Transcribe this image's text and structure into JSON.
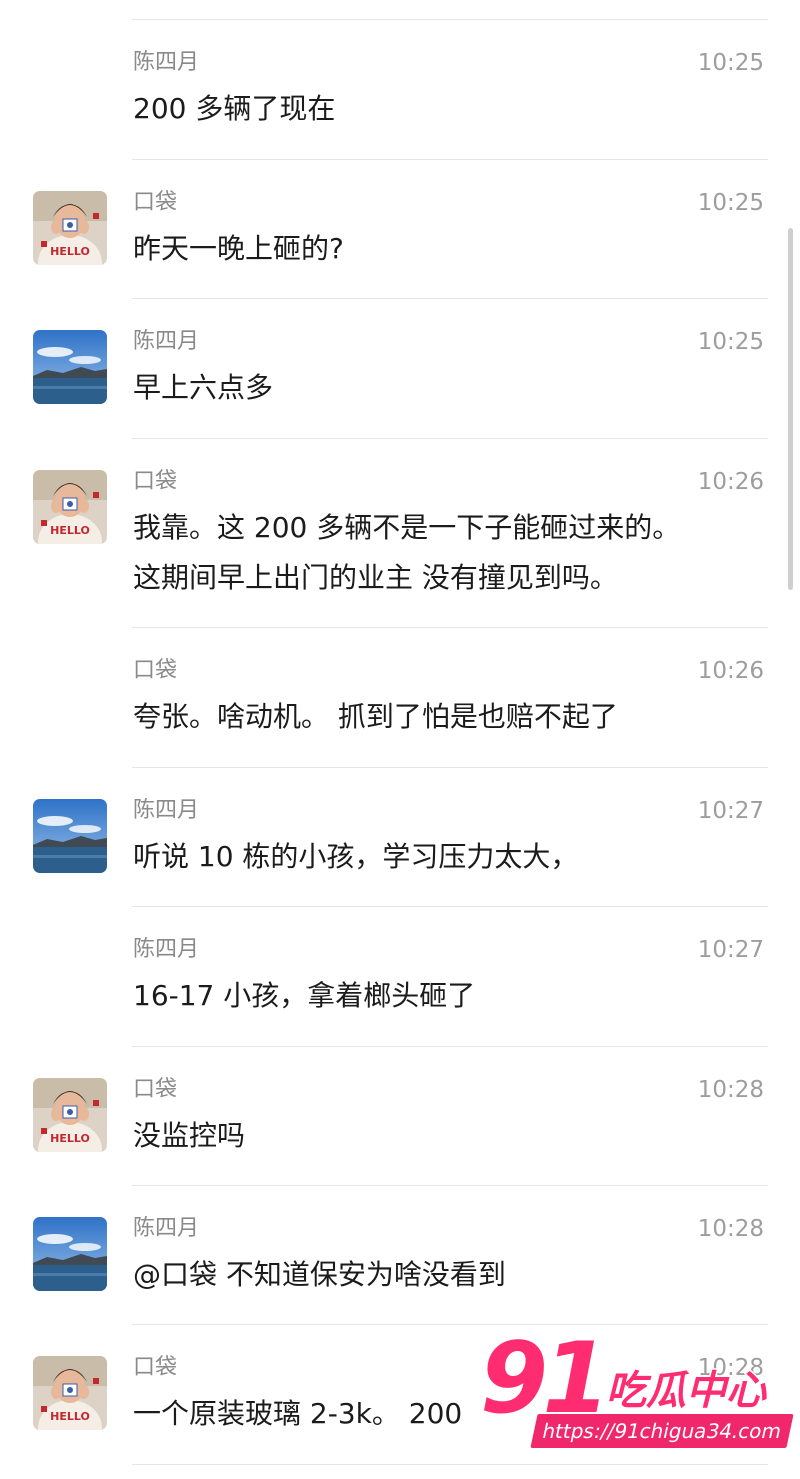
{
  "messages": [
    {
      "sender": "陈四月",
      "time": "10:25",
      "text": [
        "200 多辆了现在"
      ],
      "avatar": "none"
    },
    {
      "sender": "口袋",
      "time": "10:25",
      "text": [
        "昨天一晚上砸的?"
      ],
      "avatar": "koudai"
    },
    {
      "sender": "陈四月",
      "time": "10:25",
      "text": [
        "早上六点多"
      ],
      "avatar": "lake"
    },
    {
      "sender": "口袋",
      "time": "10:26",
      "text": [
        "我靠。这 200 多辆不是一下子能砸过来的。",
        "这期间早上出门的业主 没有撞见到吗。"
      ],
      "avatar": "koudai"
    },
    {
      "sender": "口袋",
      "time": "10:26",
      "text": [
        "夸张。啥动机。 抓到了怕是也赔不起了"
      ],
      "avatar": "none"
    },
    {
      "sender": "陈四月",
      "time": "10:27",
      "text": [
        "听说 10 栋的小孩，学习压力太大，"
      ],
      "avatar": "lake"
    },
    {
      "sender": "陈四月",
      "time": "10:27",
      "text": [
        "16-17 小孩，拿着榔头砸了"
      ],
      "avatar": "none"
    },
    {
      "sender": "口袋",
      "time": "10:28",
      "text": [
        "没监控吗"
      ],
      "avatar": "koudai"
    },
    {
      "sender": "陈四月",
      "time": "10:28",
      "text": [
        "@口袋 不知道保安为啥没看到"
      ],
      "avatar": "lake"
    },
    {
      "sender": "口袋",
      "time": "10:28",
      "text": [
        "一个原装玻璃 2-3k。 200"
      ],
      "avatar": "koudai"
    }
  ],
  "watermark": {
    "number": "91",
    "name": "吃瓜中心",
    "url": "https://91chigua34.com"
  },
  "colors": {
    "sender": "#8a8a8a",
    "time": "#9d9d9d",
    "text": "#1b1b1b",
    "watermark": "#ff2c72"
  }
}
